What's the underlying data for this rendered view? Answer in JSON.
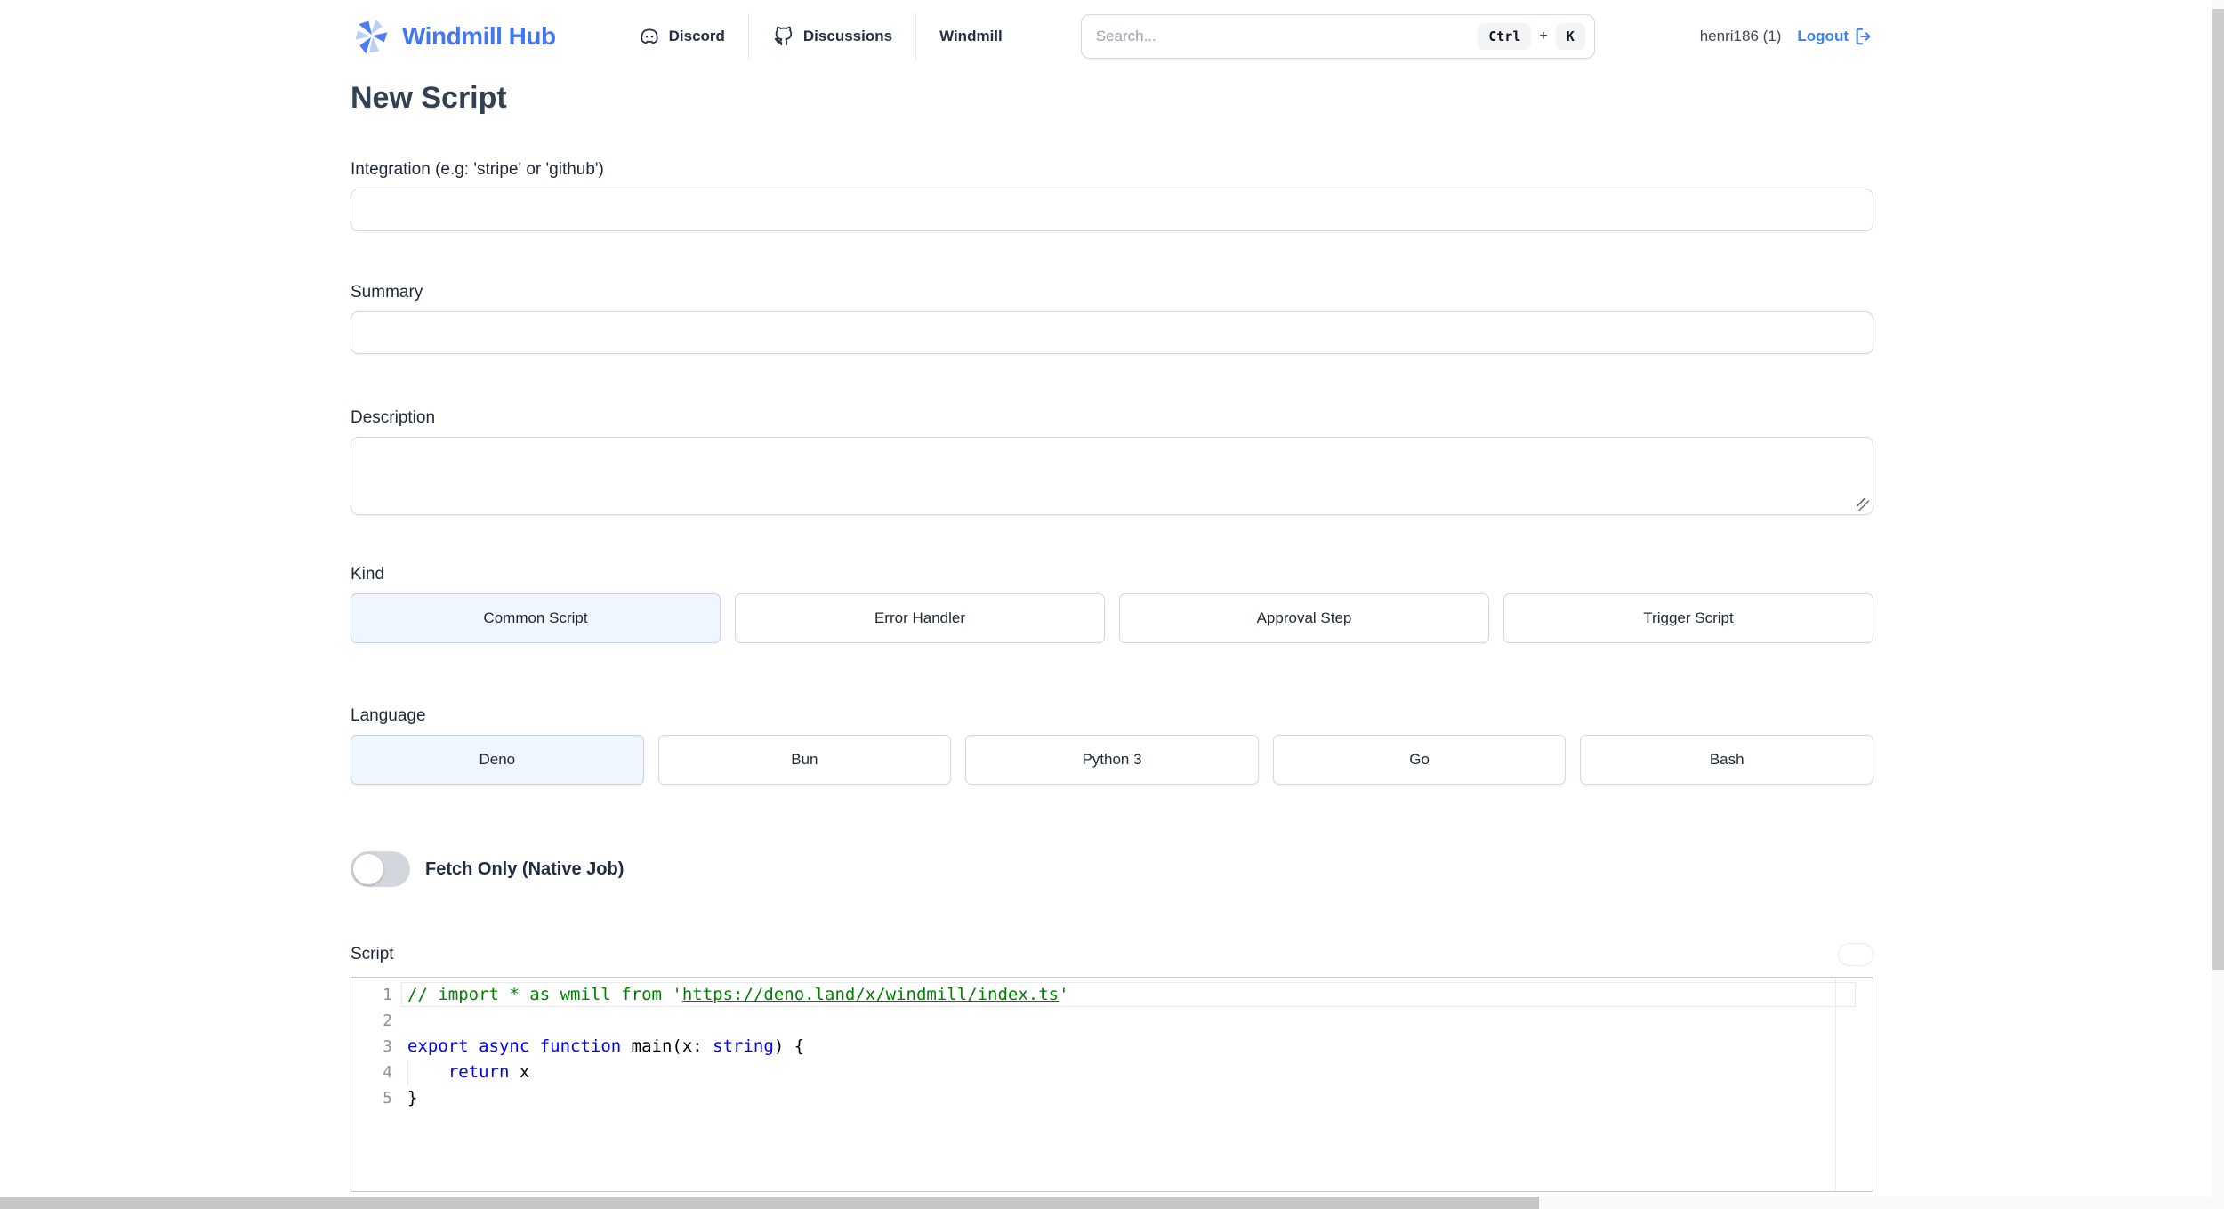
{
  "header": {
    "brand": "Windmill Hub",
    "nav": [
      {
        "label": "Discord",
        "icon": "discord-icon"
      },
      {
        "label": "Discussions",
        "icon": "github-icon"
      },
      {
        "label": "Windmill",
        "icon": ""
      }
    ],
    "search": {
      "placeholder": "Search...",
      "shortcut": [
        "Ctrl",
        "K"
      ],
      "shortcut_sep": "+"
    },
    "user": {
      "name": "henri186 (1)",
      "logout_label": "Logout"
    }
  },
  "page": {
    "title": "New Script",
    "fields": {
      "integration": {
        "label": "Integration (e.g: 'stripe' or 'github')",
        "value": ""
      },
      "summary": {
        "label": "Summary",
        "value": ""
      },
      "description": {
        "label": "Description",
        "value": ""
      }
    },
    "kind": {
      "label": "Kind",
      "options": [
        "Common Script",
        "Error Handler",
        "Approval Step",
        "Trigger Script"
      ],
      "selected": "Common Script"
    },
    "language": {
      "label": "Language",
      "options": [
        "Deno",
        "Bun",
        "Python 3",
        "Go",
        "Bash"
      ],
      "selected": "Deno"
    },
    "fetch_only": {
      "label": "Fetch Only (Native Job)",
      "enabled": false
    },
    "script": {
      "label": "Script",
      "editor_lines": [
        {
          "num": "1",
          "current": true,
          "segments": [
            {
              "t": "// import * as wmill from '",
              "c": "comment"
            },
            {
              "t": "https://deno.land/x/windmill/index.ts",
              "c": "comment",
              "u": true
            },
            {
              "t": "'",
              "c": "comment"
            }
          ]
        },
        {
          "num": "2",
          "segments": []
        },
        {
          "num": "3",
          "segments": [
            {
              "t": "export async function",
              "c": "keyword"
            },
            {
              "t": " main(x: ",
              "c": "plain"
            },
            {
              "t": "string",
              "c": "keyword"
            },
            {
              "t": ") {",
              "c": "plain"
            }
          ]
        },
        {
          "num": "4",
          "indent_guide": true,
          "segments": [
            {
              "t": "    ",
              "c": "plain"
            },
            {
              "t": "return",
              "c": "keyword"
            },
            {
              "t": " x",
              "c": "plain"
            }
          ]
        },
        {
          "num": "5",
          "segments": [
            {
              "t": "}",
              "c": "plain"
            }
          ]
        }
      ]
    }
  },
  "colors": {
    "accent": "#3b82f6",
    "brand_blue": "#4277f0",
    "selected_bg": "#eff6ff",
    "syntax_comment": "#008000",
    "syntax_keyword": "#0000ff",
    "syntax_plain": "#000000"
  }
}
